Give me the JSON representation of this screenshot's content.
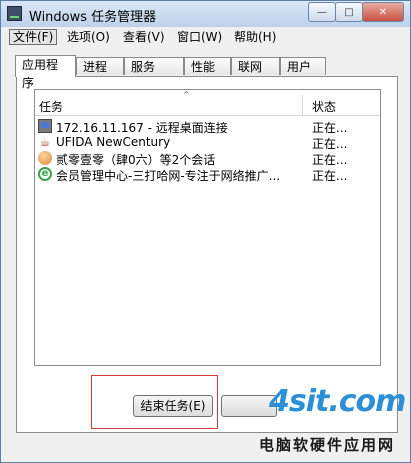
{
  "window": {
    "title": "Windows 任务管理器",
    "buttons": {
      "minimize": "—",
      "maximize": "□",
      "close": "✕"
    }
  },
  "menubar": {
    "items": [
      "文件(F)",
      "选项(O)",
      "查看(V)",
      "窗口(W)",
      "帮助(H)"
    ]
  },
  "tabs": {
    "items": [
      "应用程序",
      "进程",
      "服务",
      "性能",
      "联网",
      "用户"
    ],
    "active": "应用程序"
  },
  "task_list": {
    "sort_indicator": "^",
    "columns": {
      "task": "任务",
      "status": "状态"
    },
    "rows": [
      {
        "name": "172.16.11.167 - 远程桌面连接",
        "status": "正在...",
        "icon": "remote-desktop-icon"
      },
      {
        "name": "UFIDA NewCentury",
        "status": "正在...",
        "icon": "java-icon"
      },
      {
        "name": "贰零壹零（肆0六）等2个会话",
        "status": "正在...",
        "icon": "qq-icon"
      },
      {
        "name": "会员管理中心-三打哈网-专注于网络推广...",
        "status": "正在...",
        "icon": "ie-icon"
      }
    ]
  },
  "buttons": {
    "end_task": "结束任务(E)"
  },
  "watermark": {
    "logo": "4sit.com",
    "text": "电脑软硬件应用网"
  }
}
